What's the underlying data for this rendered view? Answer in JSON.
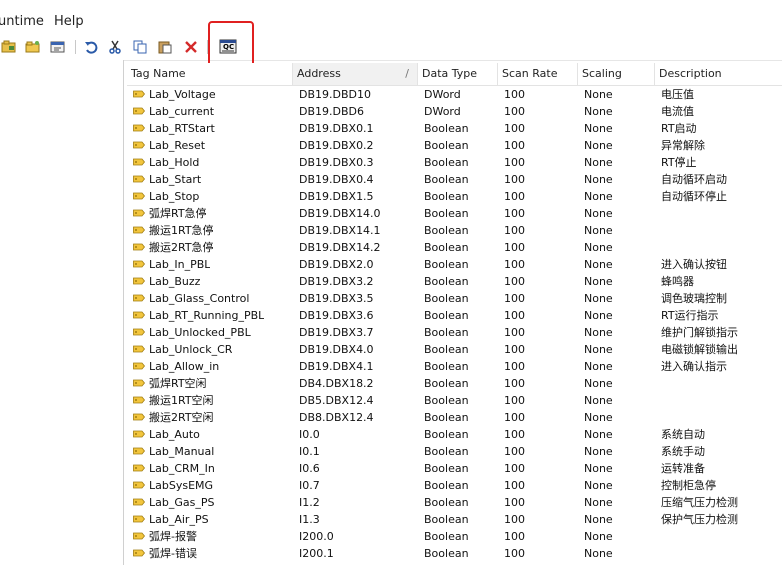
{
  "menu": {
    "runtime": "untime",
    "help": "Help"
  },
  "toolbar_icons": [
    "new-tag-icon",
    "open-folder-icon",
    "properties-icon",
    "undo-icon",
    "cut-icon",
    "copy-icon",
    "paste-icon",
    "delete-icon",
    "quick-client-icon"
  ],
  "quick_client_label": "QC",
  "columns": [
    "Tag Name",
    "Address",
    "Data Type",
    "Scan Rate",
    "Scaling",
    "Description"
  ],
  "rows": [
    {
      "name": "Lab_Voltage",
      "address": "DB19.DBD10",
      "type": "DWord",
      "rate": "100",
      "scaling": "None",
      "desc": "电压值"
    },
    {
      "name": "Lab_current",
      "address": "DB19.DBD6",
      "type": "DWord",
      "rate": "100",
      "scaling": "None",
      "desc": "电流值"
    },
    {
      "name": "Lab_RTStart",
      "address": "DB19.DBX0.1",
      "type": "Boolean",
      "rate": "100",
      "scaling": "None",
      "desc": "RT启动"
    },
    {
      "name": "Lab_Reset",
      "address": "DB19.DBX0.2",
      "type": "Boolean",
      "rate": "100",
      "scaling": "None",
      "desc": "异常解除"
    },
    {
      "name": "Lab_Hold",
      "address": "DB19.DBX0.3",
      "type": "Boolean",
      "rate": "100",
      "scaling": "None",
      "desc": "RT停止"
    },
    {
      "name": "Lab_Start",
      "address": "DB19.DBX0.4",
      "type": "Boolean",
      "rate": "100",
      "scaling": "None",
      "desc": "自动循环启动"
    },
    {
      "name": "Lab_Stop",
      "address": "DB19.DBX1.5",
      "type": "Boolean",
      "rate": "100",
      "scaling": "None",
      "desc": "自动循环停止"
    },
    {
      "name": "弧焊RT急停",
      "address": "DB19.DBX14.0",
      "type": "Boolean",
      "rate": "100",
      "scaling": "None",
      "desc": ""
    },
    {
      "name": "搬运1RT急停",
      "address": "DB19.DBX14.1",
      "type": "Boolean",
      "rate": "100",
      "scaling": "None",
      "desc": ""
    },
    {
      "name": "搬运2RT急停",
      "address": "DB19.DBX14.2",
      "type": "Boolean",
      "rate": "100",
      "scaling": "None",
      "desc": ""
    },
    {
      "name": "Lab_In_PBL",
      "address": "DB19.DBX2.0",
      "type": "Boolean",
      "rate": "100",
      "scaling": "None",
      "desc": "进入确认按钮"
    },
    {
      "name": "Lab_Buzz",
      "address": "DB19.DBX3.2",
      "type": "Boolean",
      "rate": "100",
      "scaling": "None",
      "desc": "蜂鸣器"
    },
    {
      "name": "Lab_Glass_Control",
      "address": "DB19.DBX3.5",
      "type": "Boolean",
      "rate": "100",
      "scaling": "None",
      "desc": "调色玻璃控制"
    },
    {
      "name": "Lab_RT_Running_PBL",
      "address": "DB19.DBX3.6",
      "type": "Boolean",
      "rate": "100",
      "scaling": "None",
      "desc": "RT运行指示"
    },
    {
      "name": "Lab_Unlocked_PBL",
      "address": "DB19.DBX3.7",
      "type": "Boolean",
      "rate": "100",
      "scaling": "None",
      "desc": "维护门解锁指示"
    },
    {
      "name": "Lab_Unlock_CR",
      "address": "DB19.DBX4.0",
      "type": "Boolean",
      "rate": "100",
      "scaling": "None",
      "desc": "电磁锁解锁输出"
    },
    {
      "name": "Lab_Allow_in",
      "address": "DB19.DBX4.1",
      "type": "Boolean",
      "rate": "100",
      "scaling": "None",
      "desc": "进入确认指示"
    },
    {
      "name": "弧焊RT空闲",
      "address": "DB4.DBX18.2",
      "type": "Boolean",
      "rate": "100",
      "scaling": "None",
      "desc": ""
    },
    {
      "name": "搬运1RT空闲",
      "address": "DB5.DBX12.4",
      "type": "Boolean",
      "rate": "100",
      "scaling": "None",
      "desc": ""
    },
    {
      "name": "搬运2RT空闲",
      "address": "DB8.DBX12.4",
      "type": "Boolean",
      "rate": "100",
      "scaling": "None",
      "desc": ""
    },
    {
      "name": "Lab_Auto",
      "address": "I0.0",
      "type": "Boolean",
      "rate": "100",
      "scaling": "None",
      "desc": "系统自动"
    },
    {
      "name": "Lab_Manual",
      "address": "I0.1",
      "type": "Boolean",
      "rate": "100",
      "scaling": "None",
      "desc": "系统手动"
    },
    {
      "name": "Lab_CRM_In",
      "address": "I0.6",
      "type": "Boolean",
      "rate": "100",
      "scaling": "None",
      "desc": "运转准备"
    },
    {
      "name": "LabSysEMG",
      "address": "I0.7",
      "type": "Boolean",
      "rate": "100",
      "scaling": "None",
      "desc": "控制柜急停"
    },
    {
      "name": "Lab_Gas_PS",
      "address": "I1.2",
      "type": "Boolean",
      "rate": "100",
      "scaling": "None",
      "desc": "压缩气压力检测"
    },
    {
      "name": "Lab_Air_PS",
      "address": "I1.3",
      "type": "Boolean",
      "rate": "100",
      "scaling": "None",
      "desc": "保护气压力检测"
    },
    {
      "name": "弧焊-报警",
      "address": "I200.0",
      "type": "Boolean",
      "rate": "100",
      "scaling": "None",
      "desc": ""
    },
    {
      "name": "弧焊-错误",
      "address": "I200.1",
      "type": "Boolean",
      "rate": "100",
      "scaling": "None",
      "desc": ""
    }
  ]
}
